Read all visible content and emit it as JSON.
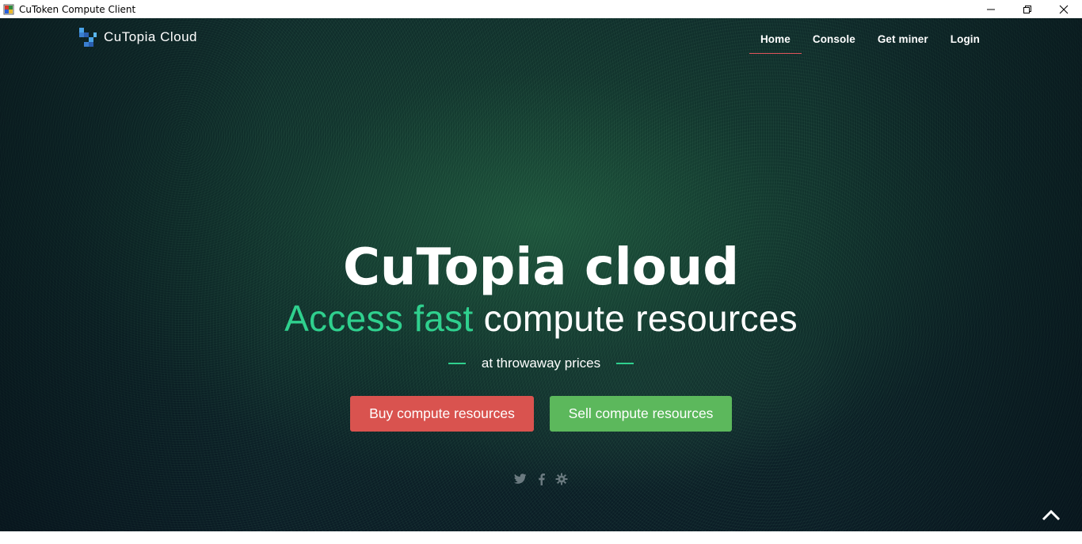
{
  "window": {
    "title": "CuToken Compute Client",
    "controls": [
      "minimize-icon",
      "restore-icon",
      "close-icon"
    ]
  },
  "navbar": {
    "brand": "CuTopia Cloud",
    "links": [
      {
        "label": "Home",
        "active": true
      },
      {
        "label": "Console",
        "active": false
      },
      {
        "label": "Get miner",
        "active": false
      },
      {
        "label": "Login",
        "active": false
      }
    ]
  },
  "hero": {
    "title": "CuTopia cloud",
    "subtitle_accent": "Access fast",
    "subtitle_rest": "compute resources",
    "tagline": "at throwaway prices",
    "buy_button": "Buy compute resources",
    "sell_button": "Sell compute resources",
    "social_icons": [
      "twitter-icon",
      "facebook-icon",
      "gear-icon"
    ]
  },
  "colors": {
    "accent": "#2fd08e",
    "buy": "#d9534f",
    "sell": "#5cb85c",
    "nav_active_underline": "#e0545a"
  }
}
